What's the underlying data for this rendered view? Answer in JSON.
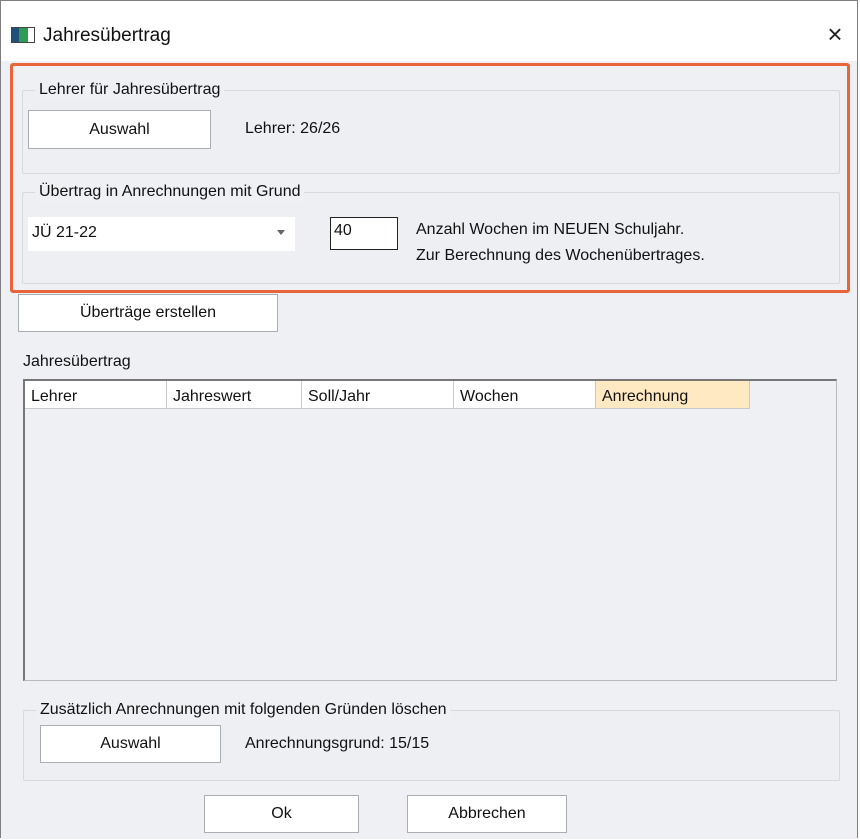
{
  "window": {
    "title": "Jahresübertrag",
    "close_icon": "×"
  },
  "group_teachers": {
    "title": "Lehrer für Jahresübertrag",
    "button_label": "Auswahl",
    "status": "Lehrer: 26/26"
  },
  "group_transfer": {
    "title": "Übertrag in Anrechnungen mit Grund",
    "reason_selected": "JÜ 21-22",
    "weeks_value": "40",
    "hint_line1": "Anzahl Wochen im NEUEN Schuljahr.",
    "hint_line2": "Zur Berechnung des Wochenübertrages."
  },
  "create_button_label": "Überträge erstellen",
  "table": {
    "title": "Jahresübertrag",
    "columns": [
      "Lehrer",
      "Jahreswert",
      "Soll/Jahr",
      "Wochen",
      "Anrechnung"
    ],
    "rows": []
  },
  "group_delete": {
    "title": "Zusätzlich Anrechnungen mit folgenden Gründen löschen",
    "button_label": "Auswahl",
    "status": "Anrechnungsgrund: 15/15"
  },
  "footer": {
    "ok_label": "Ok",
    "cancel_label": "Abbrechen"
  },
  "colors": {
    "highlight_border": "#e8643a",
    "active_column": "#ffe9c2",
    "panel_bg": "#eef0f3"
  }
}
